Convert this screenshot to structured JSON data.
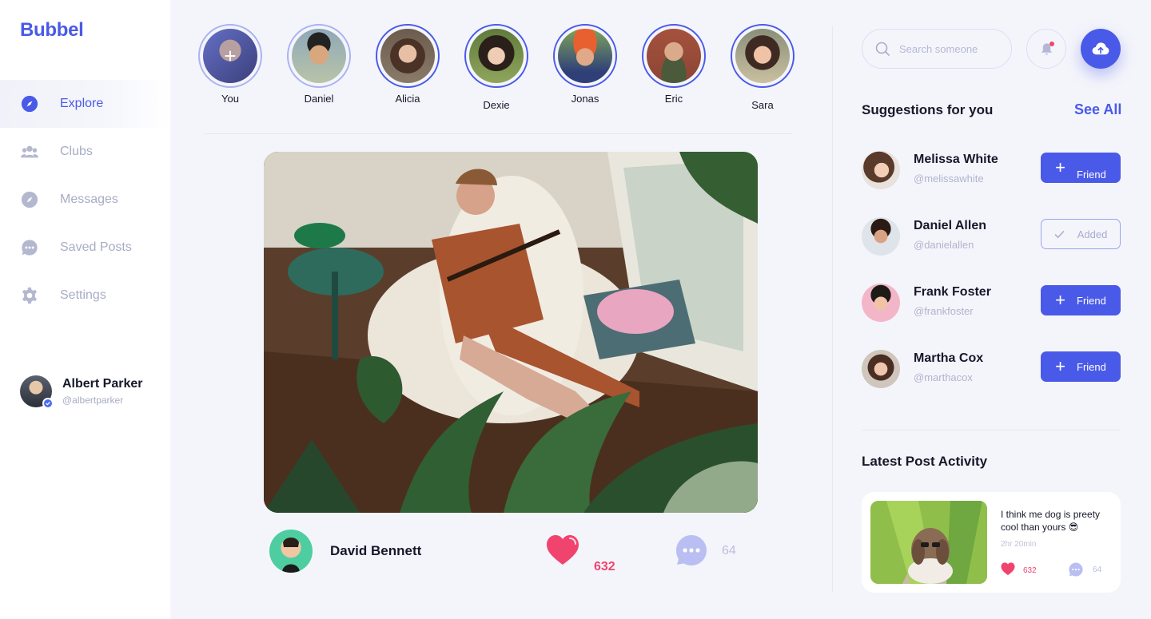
{
  "app": {
    "logo": "Bubbel",
    "accent": "#4a5ae8",
    "like_color": "#f0446f"
  },
  "sidebar": {
    "items": [
      {
        "label": "Explore",
        "icon": "compass-icon",
        "active": true
      },
      {
        "label": "Clubs",
        "icon": "users-icon",
        "active": false
      },
      {
        "label": "Messages",
        "icon": "compass-icon",
        "active": false
      },
      {
        "label": "Saved Posts",
        "icon": "chat-bubble-icon",
        "active": false
      },
      {
        "label": "Settings",
        "icon": "gear-icon",
        "active": false
      }
    ],
    "profile": {
      "name": "Albert Parker",
      "handle": "@albertparker",
      "verified": true
    }
  },
  "stories": [
    {
      "name": "You",
      "is_add": true
    },
    {
      "name": "Daniel"
    },
    {
      "name": "Alicia"
    },
    {
      "name": "Dexie"
    },
    {
      "name": "Jonas"
    },
    {
      "name": "Eric"
    },
    {
      "name": "Sara"
    }
  ],
  "post": {
    "author": "David Bennett",
    "likes": "632",
    "comments": "64"
  },
  "header": {
    "search_placeholder": "Search someone",
    "notification_unread": true
  },
  "suggestions": {
    "title": "Suggestions for you",
    "see_all": "See All",
    "items": [
      {
        "name": "Melissa White",
        "handle": "@melissawhite",
        "button": "Friend",
        "state": "add"
      },
      {
        "name": "Daniel Allen",
        "handle": "@danielallen",
        "button": "Added",
        "state": "added"
      },
      {
        "name": "Frank Foster",
        "handle": "@frankfoster",
        "button": "Friend",
        "state": "add"
      },
      {
        "name": "Martha Cox",
        "handle": "@marthacox",
        "button": "Friend",
        "state": "add"
      }
    ]
  },
  "activity": {
    "title": "Latest Post Activity",
    "text": "I think me dog is preety cool than yours 😎",
    "time": "2hr 20min",
    "likes": "632",
    "comments": "64"
  }
}
